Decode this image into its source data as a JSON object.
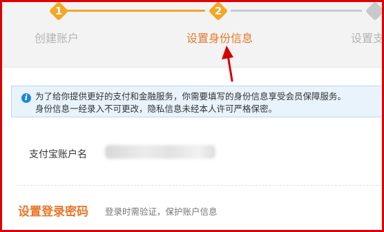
{
  "steps": [
    {
      "number": "1",
      "label": "创建账户",
      "state": "done"
    },
    {
      "number": "2",
      "label": "设置身份信息",
      "state": "current"
    },
    {
      "number": "",
      "label": "设置支",
      "state": "pending"
    }
  ],
  "notice": {
    "icon": "info-icon",
    "line1": "为了给你提供更好的支付和金融服务，你需要填写的身份信息享受会员保障服务。",
    "line2": "身份信息一经录入不可更改，隐私信息未经本人许可严格保密。"
  },
  "account": {
    "label": "支付宝账户名"
  },
  "password_section": {
    "title": "设置登录密码",
    "description": "登录时需验证，保护账户信息"
  },
  "colors": {
    "accent": "#f5a623",
    "accent_text": "#e8772b",
    "inactive": "#c9c9c9",
    "frame": "#e10000",
    "arrow": "#d40000",
    "info_blue": "#1e88d9"
  }
}
